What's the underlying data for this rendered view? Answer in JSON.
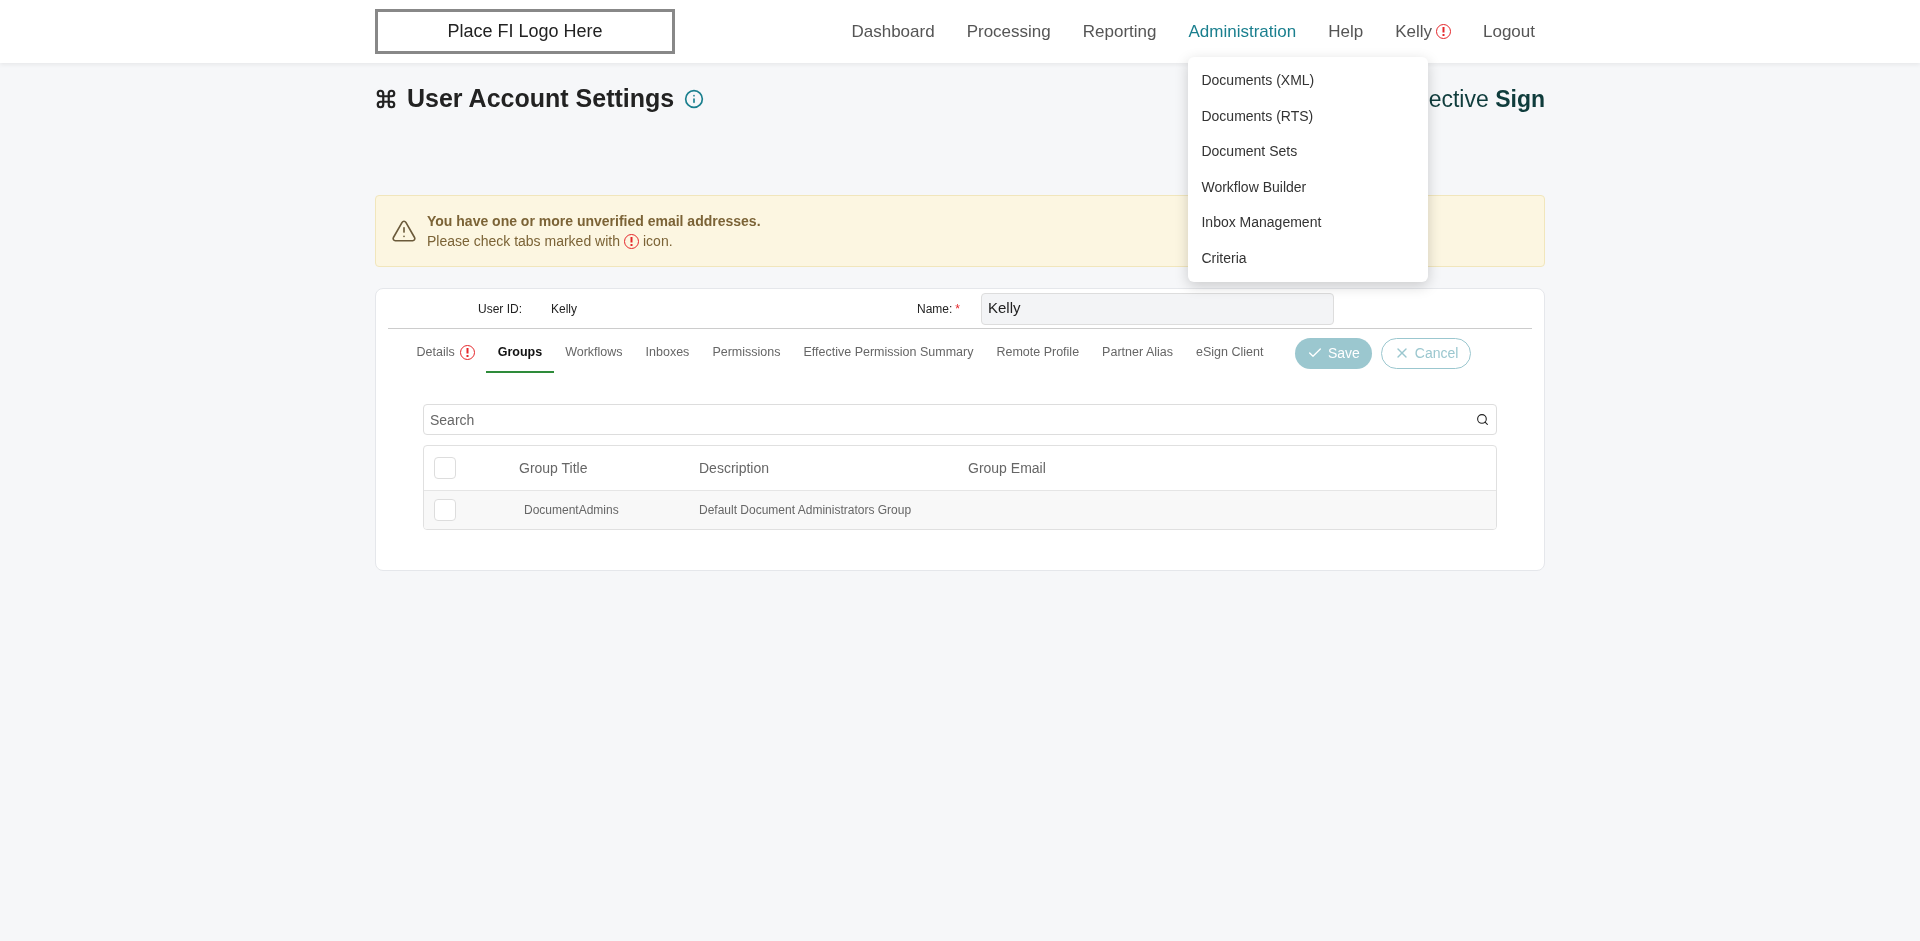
{
  "header": {
    "logo": "Place FI Logo Here",
    "nav": [
      {
        "label": "Dashboard",
        "selected": false,
        "warning": false
      },
      {
        "label": "Processing",
        "selected": false,
        "warning": false
      },
      {
        "label": "Reporting",
        "selected": false,
        "warning": false
      },
      {
        "label": "Administration",
        "selected": true,
        "warning": false
      },
      {
        "label": "Help",
        "selected": false,
        "warning": false
      },
      {
        "label": "Kelly",
        "selected": false,
        "warning": true
      },
      {
        "label": "Logout",
        "selected": false,
        "warning": false
      }
    ],
    "dropdown": [
      "Documents (XML)",
      "Documents (RTS)",
      "Document Sets",
      "Workflow Builder",
      "Inbox Management",
      "Criteria"
    ]
  },
  "page": {
    "title": "User Account Settings",
    "brand": "ective **Sign**"
  },
  "alert": {
    "heading": "You have one or more unverified email addresses.",
    "text_before": "Please check tabs marked with",
    "text_after": "icon."
  },
  "form": {
    "user_id_label": "User ID:",
    "user_id": "Kelly",
    "name_label": "Name:",
    "required_mark": "*",
    "name_value": "Kelly"
  },
  "tabs": [
    {
      "label": "Details",
      "selected": false,
      "warning": true
    },
    {
      "label": "Groups",
      "selected": true,
      "warning": false
    },
    {
      "label": "Workflows",
      "selected": false,
      "warning": false
    },
    {
      "label": "Inboxes",
      "selected": false,
      "warning": false
    },
    {
      "label": "Permissions",
      "selected": false,
      "warning": false
    },
    {
      "label": "Effective Permission Summary",
      "selected": false,
      "warning": false
    },
    {
      "label": "Remote Profile",
      "selected": false,
      "warning": false
    },
    {
      "label": "Partner Alias",
      "selected": false,
      "warning": false
    },
    {
      "label": "eSign Client",
      "selected": false,
      "warning": false
    }
  ],
  "buttons": {
    "save": "Save",
    "save_disabled": true,
    "cancel": "Cancel"
  },
  "search": {
    "placeholder": "Search"
  },
  "table": {
    "header_checked": false,
    "columns": [
      "Group Title",
      "Description",
      "Group Email"
    ],
    "rows": [
      {
        "checked": false,
        "cells": [
          "DocumentAdmins",
          "Default Document Administrators Group",
          ""
        ]
      }
    ]
  }
}
